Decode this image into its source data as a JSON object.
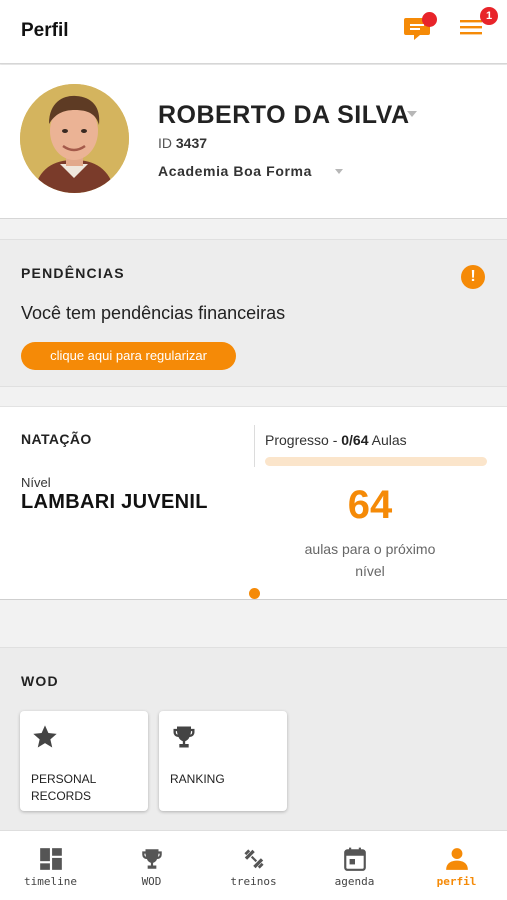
{
  "colors": {
    "accent": "#f58a07",
    "badge": "#e8242a",
    "progress_track": "#fbe5cb"
  },
  "header": {
    "title": "Perfil",
    "notification_count": "1",
    "icons": [
      "chat-icon",
      "menu-icon"
    ]
  },
  "profile": {
    "name": "ROBERTO DA SILVA",
    "id_label": "ID",
    "id_value": "3437",
    "gym": "Academia Boa Forma"
  },
  "pending": {
    "title": "PENDÊNCIAS",
    "alert": "!",
    "message": "Você tem pendências financeiras",
    "action": "clique aqui para regularizar"
  },
  "course": {
    "title": "NATAÇÃO",
    "progress_prefix": "Progresso - ",
    "progress_value": "0/64",
    "progress_suffix": " Aulas",
    "progress_fraction": 0,
    "level_caption": "Nível",
    "level_name": "LAMBARI JUVENIL",
    "remaining": "64",
    "remaining_text": "aulas para o próximo nível"
  },
  "wod": {
    "title": "WOD",
    "cards": [
      {
        "label": "PERSONAL RECORDS",
        "icon": "star-icon"
      },
      {
        "label": "RANKING",
        "icon": "trophy-icon"
      }
    ]
  },
  "tabs": [
    {
      "label": "timeline",
      "icon": "dashboard-icon",
      "active": false
    },
    {
      "label": "WOD",
      "icon": "trophy-icon",
      "active": false
    },
    {
      "label": "treinos",
      "icon": "dumbbell-icon",
      "active": false
    },
    {
      "label": "agenda",
      "icon": "calendar-icon",
      "active": false
    },
    {
      "label": "perfil",
      "icon": "person-icon",
      "active": true
    }
  ]
}
